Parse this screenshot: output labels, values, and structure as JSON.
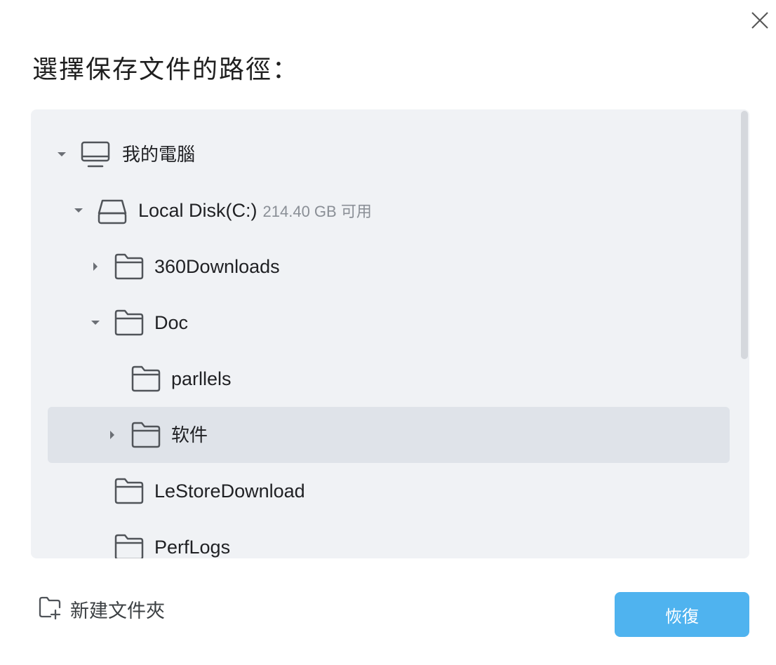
{
  "dialog": {
    "title": "選擇保存文件的路徑：",
    "close_icon": "close-icon"
  },
  "tree": {
    "items": [
      {
        "label": "我的電腦",
        "icon": "computer-icon",
        "expanded": true
      },
      {
        "label": "Local Disk(C:)",
        "extra": "214.40 GB 可用",
        "icon": "drive-icon",
        "expanded": true
      },
      {
        "label": "360Downloads",
        "icon": "folder-icon",
        "expanded": false
      },
      {
        "label": "Doc",
        "icon": "folder-icon",
        "expanded": true
      },
      {
        "label": "parllels",
        "icon": "folder-icon"
      },
      {
        "label": "软件",
        "icon": "folder-icon",
        "expanded": false,
        "selected": true
      },
      {
        "label": "LeStoreDownload",
        "icon": "folder-icon"
      },
      {
        "label": "PerfLogs",
        "icon": "folder-icon"
      }
    ]
  },
  "footer": {
    "new_folder_label": "新建文件夾",
    "restore_label": "恢復"
  },
  "colors": {
    "panel_bg": "#f0f2f5",
    "selected_row": "#dfe3e9",
    "primary_button": "#4fb3ef"
  }
}
